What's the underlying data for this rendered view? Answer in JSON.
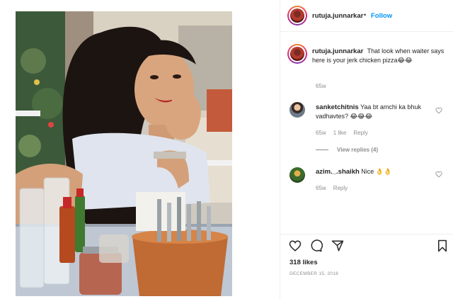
{
  "window": {
    "close_glyph": "×"
  },
  "post": {
    "author": "rutuja.junnarkar",
    "separator": "•",
    "follow_label": "Follow",
    "caption_user": "rutuja.junnarkar",
    "caption_text": "That look when waiter says here is your jerk chicken pizza😂😂",
    "caption_time": "65w",
    "likes": "318 likes",
    "date": "DECEMBER 15, 2018",
    "photo_icon": "photo"
  },
  "comments": [
    {
      "user": "sanketchitnis",
      "text": "Yaa bt amchi ka bhuk vadhavtes? 😂😂😂",
      "time": "65w",
      "likes": "1 like",
      "reply": "Reply",
      "view_replies": "View replies (4)"
    },
    {
      "user": "azim._.shaikh",
      "text": "Nice 👌👌",
      "time": "65w",
      "reply": "Reply"
    }
  ],
  "icons": {
    "like": "heart-icon",
    "comment": "comment-icon",
    "share": "share-icon",
    "save": "bookmark-icon",
    "comment_like": "heart-icon"
  },
  "colors": {
    "accent": "#0095f6",
    "muted": "#8e8e8e",
    "text": "#262626",
    "border": "#efefef"
  }
}
